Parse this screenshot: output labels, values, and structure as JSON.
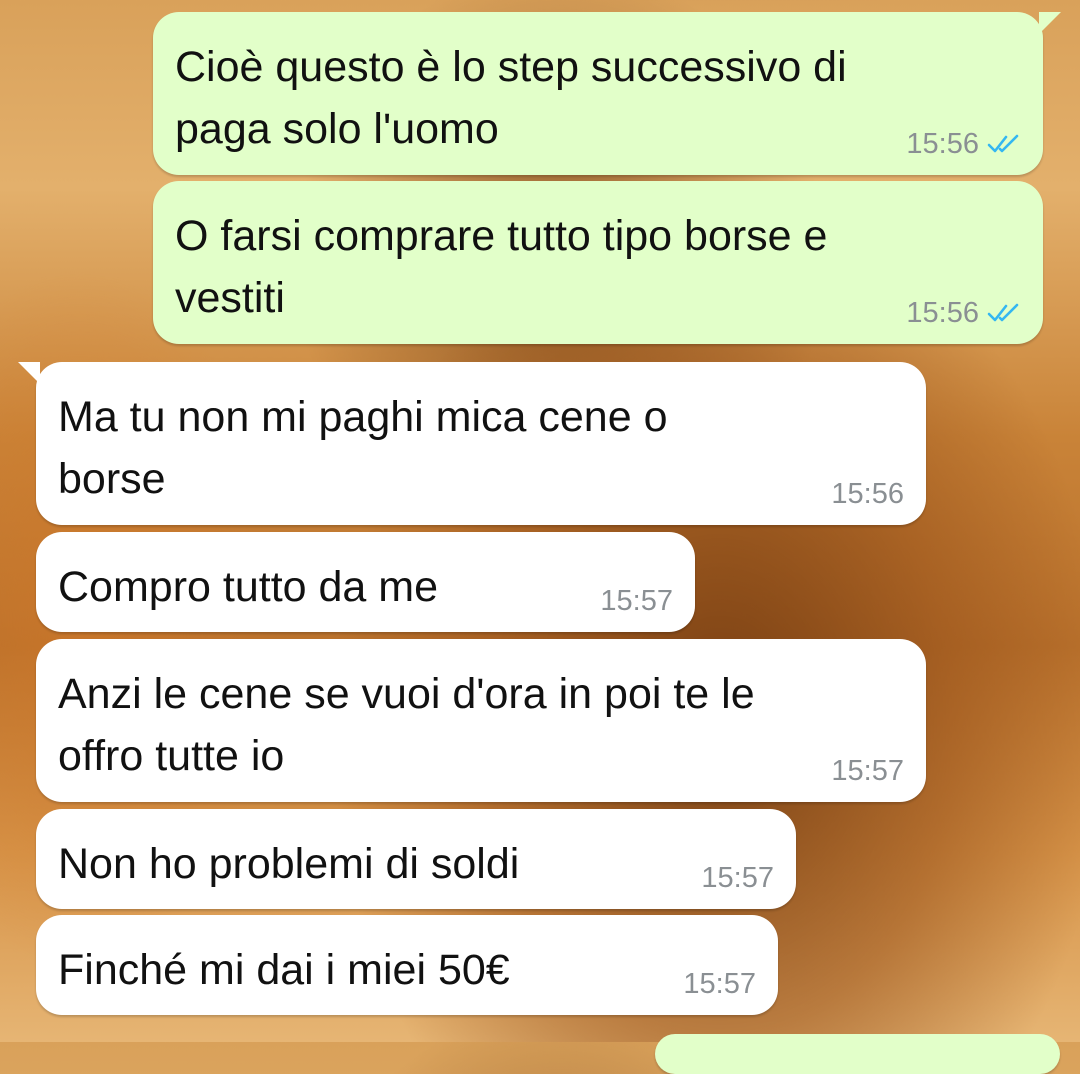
{
  "conversation": {
    "messages": [
      {
        "direction": "outgoing",
        "text": "Cioè questo è lo step successivo di\npaga solo l'uomo",
        "time": "15:56",
        "status": "read"
      },
      {
        "direction": "outgoing",
        "text": "O farsi comprare tutto tipo borse e\nvestiti",
        "time": "15:56",
        "status": "read"
      },
      {
        "direction": "incoming",
        "text": "Ma tu non mi paghi mica cene o\nborse",
        "time": "15:56"
      },
      {
        "direction": "incoming",
        "text": "Compro tutto da me",
        "time": "15:57"
      },
      {
        "direction": "incoming",
        "text": "Anzi le cene se vuoi d'ora in poi te le\noffro tutte io",
        "time": "15:57"
      },
      {
        "direction": "incoming",
        "text": "Non ho problemi di soldi",
        "time": "15:57"
      },
      {
        "direction": "incoming",
        "text": "Finché mi dai i miei 50€",
        "time": "15:57"
      }
    ]
  },
  "colors": {
    "outgoing_bubble": "#e2ffc9",
    "incoming_bubble": "#ffffff",
    "read_ticks": "#34b7f1",
    "timestamp": "#8a8f93"
  },
  "icons": {
    "read_receipt": "double-check-icon"
  }
}
